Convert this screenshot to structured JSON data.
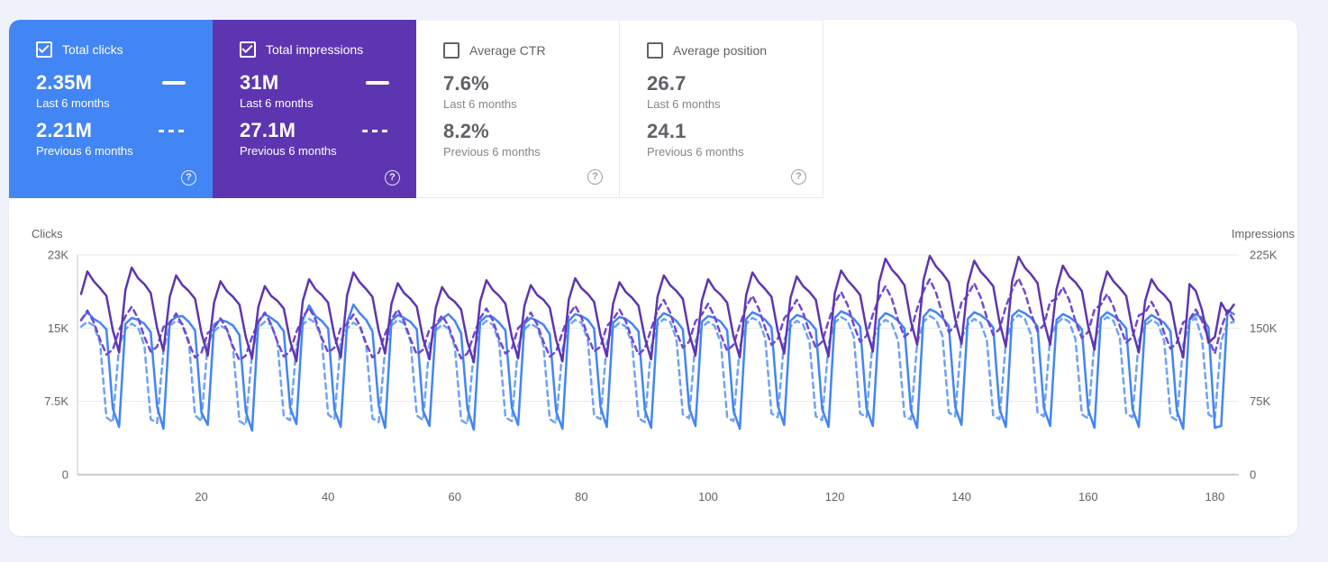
{
  "cards": [
    {
      "id": "total-clicks",
      "label": "Total clicks",
      "checked": true,
      "color": "#4285f4",
      "value_current": "2.35M",
      "caption_current": "Last 6 months",
      "value_previous": "2.21M",
      "caption_previous": "Previous 6 months",
      "help_glyph": "?"
    },
    {
      "id": "total-impressions",
      "label": "Total impressions",
      "checked": true,
      "color": "#5e35b1",
      "value_current": "31M",
      "caption_current": "Last 6 months",
      "value_previous": "27.1M",
      "caption_previous": "Previous 6 months",
      "help_glyph": "?"
    },
    {
      "id": "average-ctr",
      "label": "Average CTR",
      "checked": false,
      "color": "",
      "value_current": "7.6%",
      "caption_current": "Last 6 months",
      "value_previous": "8.2%",
      "caption_previous": "Previous 6 months",
      "help_glyph": "?"
    },
    {
      "id": "average-position",
      "label": "Average position",
      "checked": false,
      "color": "",
      "value_current": "26.7",
      "caption_current": "Last 6 months",
      "value_previous": "24.1",
      "caption_previous": "Previous 6 months",
      "help_glyph": "?"
    }
  ],
  "chart_data": {
    "type": "line",
    "x_range": [
      1,
      183
    ],
    "x_ticks": [
      20,
      40,
      60,
      80,
      100,
      120,
      140,
      160,
      180
    ],
    "grid": true,
    "values_unit": "thousands",
    "left_axis": {
      "title": "Clicks",
      "max": 23,
      "tick_labels": [
        "23K",
        "15K",
        "7.5K",
        "0"
      ],
      "tick_values": [
        225,
        150,
        75,
        0
      ]
    },
    "right_axis": {
      "title": "Impressions",
      "max": 225,
      "tick_labels": [
        "225K",
        "150K",
        "75K",
        "0"
      ],
      "tick_values": [
        225,
        150,
        75,
        0
      ]
    },
    "series": [
      {
        "name": "Clicks - Last 6 months",
        "axis": "left",
        "style": "solid",
        "color": "#4285f4",
        "values": [
          16.2,
          17.0,
          16.3,
          15.9,
          15.2,
          6.9,
          5.0,
          15.8,
          16.4,
          16.2,
          15.8,
          14.9,
          7.1,
          4.8,
          16.0,
          16.5,
          16.6,
          16.0,
          15.1,
          6.5,
          5.2,
          15.7,
          16.2,
          16.0,
          15.6,
          14.6,
          6.6,
          4.6,
          16.1,
          16.8,
          16.4,
          15.9,
          15.0,
          7.0,
          5.3,
          16.2,
          17.7,
          16.6,
          16.1,
          15.3,
          6.8,
          5.0,
          15.9,
          17.8,
          16.9,
          16.2,
          15.0,
          7.2,
          4.9,
          16.1,
          16.7,
          16.4,
          16.0,
          15.2,
          6.7,
          5.1,
          15.6,
          16.3,
          16.8,
          16.1,
          14.8,
          6.9,
          4.7,
          16.0,
          16.6,
          16.5,
          15.9,
          15.1,
          7.0,
          5.2,
          15.8,
          16.4,
          16.1,
          15.7,
          14.7,
          6.6,
          4.8,
          16.1,
          16.8,
          16.6,
          16.2,
          15.3,
          7.1,
          5.0,
          15.9,
          16.5,
          16.3,
          15.8,
          15.0,
          6.8,
          4.9,
          16.2,
          16.9,
          16.6,
          16.1,
          15.2,
          7.0,
          5.1,
          16.0,
          16.6,
          16.4,
          16.0,
          15.1,
          6.7,
          4.8,
          16.3,
          17.0,
          16.7,
          16.2,
          15.4,
          7.2,
          5.2,
          16.1,
          16.7,
          16.5,
          16.0,
          15.2,
          6.9,
          5.0,
          16.4,
          17.1,
          16.8,
          16.3,
          15.5,
          7.0,
          5.1,
          16.2,
          16.9,
          16.6,
          16.1,
          15.3,
          6.8,
          4.9,
          16.5,
          17.3,
          17.0,
          16.4,
          15.6,
          7.1,
          5.2,
          16.3,
          17.0,
          16.7,
          16.2,
          15.4,
          6.9,
          5.0,
          16.6,
          17.2,
          16.9,
          16.4,
          15.5,
          7.0,
          5.1,
          16.2,
          16.8,
          16.5,
          16.0,
          15.2,
          6.8,
          4.9,
          16.4,
          17.0,
          16.6,
          16.1,
          15.3,
          6.9,
          5.0,
          16.1,
          16.7,
          16.3,
          15.9,
          15.0,
          6.7,
          4.8,
          16.2,
          16.8,
          16.4,
          15.4,
          4.9,
          5.1,
          17.2,
          16.8
        ]
      },
      {
        "name": "Clicks - Previous 6 months",
        "axis": "left",
        "style": "dashed",
        "color": "#6da2f8",
        "values": [
          15.5,
          16.0,
          15.6,
          13.8,
          6.0,
          5.5,
          13.5,
          15.2,
          15.8,
          15.4,
          13.5,
          5.8,
          5.4,
          13.0,
          15.6,
          16.1,
          15.8,
          14.0,
          6.2,
          5.6,
          13.8,
          15.0,
          15.6,
          15.2,
          13.2,
          5.6,
          5.2,
          12.8,
          15.4,
          16.0,
          15.7,
          13.9,
          6.1,
          5.7,
          13.4,
          15.7,
          16.3,
          15.9,
          14.2,
          6.3,
          5.8,
          14.0,
          15.3,
          15.9,
          15.5,
          13.6,
          5.9,
          5.5,
          13.2,
          15.6,
          16.2,
          15.8,
          14.0,
          6.2,
          5.7,
          13.7,
          15.1,
          15.7,
          15.3,
          13.4,
          5.7,
          5.3,
          12.9,
          15.5,
          16.1,
          15.7,
          13.8,
          6.0,
          5.6,
          13.5,
          15.2,
          15.8,
          15.4,
          13.5,
          5.8,
          5.4,
          13.1,
          15.6,
          16.2,
          15.9,
          14.1,
          6.2,
          5.8,
          13.8,
          15.3,
          15.9,
          15.5,
          13.7,
          5.9,
          5.5,
          13.3,
          15.7,
          16.3,
          16.0,
          14.2,
          6.3,
          5.9,
          14.0,
          15.4,
          16.0,
          15.6,
          13.8,
          6.0,
          5.6,
          13.4,
          15.8,
          16.4,
          16.1,
          14.3,
          6.4,
          6.0,
          14.1,
          15.5,
          16.1,
          15.7,
          13.9,
          6.1,
          5.7,
          13.6,
          15.9,
          16.5,
          16.1,
          14.4,
          6.4,
          6.0,
          14.2,
          15.6,
          16.2,
          15.8,
          14.0,
          6.1,
          5.8,
          13.7,
          16.0,
          16.6,
          16.2,
          14.5,
          6.5,
          6.1,
          14.3,
          15.7,
          16.3,
          15.9,
          14.1,
          6.2,
          5.8,
          13.8,
          16.1,
          16.7,
          16.3,
          14.6,
          6.5,
          6.1,
          14.4,
          15.8,
          16.4,
          16.0,
          14.2,
          6.3,
          5.9,
          13.9,
          16.0,
          16.5,
          16.1,
          14.3,
          6.4,
          6.0,
          14.1,
          15.6,
          16.2,
          15.8,
          14.0,
          6.1,
          5.7,
          13.6,
          15.9,
          16.4,
          14.2,
          6.3,
          5.9,
          14.0,
          15.8,
          16.0
        ]
      },
      {
        "name": "Impressions - Last 6 months",
        "axis": "right",
        "style": "solid",
        "color": "#5e35b1",
        "values": [
          185,
          208,
          198,
          191,
          183,
          148,
          125,
          189,
          212,
          201,
          195,
          186,
          150,
          127,
          182,
          204,
          194,
          188,
          180,
          145,
          122,
          176,
          198,
          188,
          182,
          174,
          141,
          119,
          172,
          193,
          183,
          178,
          170,
          137,
          116,
          178,
          200,
          190,
          184,
          176,
          142,
          120,
          184,
          207,
          197,
          190,
          182,
          147,
          124,
          175,
          196,
          186,
          180,
          172,
          139,
          118,
          171,
          192,
          182,
          177,
          169,
          136,
          115,
          177,
          199,
          189,
          183,
          175,
          141,
          119,
          173,
          194,
          184,
          179,
          171,
          138,
          116,
          179,
          201,
          191,
          185,
          177,
          143,
          121,
          175,
          197,
          187,
          181,
          173,
          140,
          118,
          182,
          204,
          194,
          188,
          180,
          145,
          122,
          178,
          200,
          190,
          184,
          176,
          142,
          120,
          184,
          207,
          197,
          190,
          182,
          147,
          124,
          181,
          203,
          193,
          187,
          179,
          144,
          121,
          186,
          209,
          199,
          192,
          184,
          149,
          126,
          197,
          221,
          210,
          203,
          194,
          157,
          133,
          199,
          224,
          213,
          206,
          197,
          159,
          134,
          195,
          219,
          208,
          201,
          193,
          156,
          131,
          198,
          223,
          212,
          205,
          196,
          158,
          133,
          190,
          214,
          203,
          197,
          188,
          152,
          128,
          185,
          208,
          198,
          191,
          183,
          148,
          125,
          178,
          200,
          190,
          184,
          176,
          142,
          120,
          195,
          188,
          168,
          135,
          141,
          176,
          165,
          174
        ]
      },
      {
        "name": "Impressions - Previous 6 months",
        "axis": "right",
        "style": "dashed",
        "color": "#7248d0",
        "values": [
          158,
          168,
          156,
          138,
          123,
          128,
          148,
          162,
          172,
          160,
          141,
          126,
          131,
          151,
          155,
          165,
          153,
          135,
          120,
          125,
          145,
          150,
          160,
          149,
          131,
          117,
          122,
          141,
          156,
          166,
          154,
          136,
          121,
          126,
          146,
          161,
          171,
          159,
          140,
          125,
          130,
          150,
          154,
          164,
          153,
          134,
          120,
          125,
          144,
          159,
          169,
          157,
          139,
          123,
          128,
          149,
          153,
          163,
          152,
          134,
          119,
          124,
          143,
          160,
          170,
          158,
          139,
          124,
          129,
          150,
          156,
          166,
          154,
          136,
          121,
          126,
          146,
          163,
          173,
          161,
          142,
          126,
          131,
          152,
          159,
          169,
          157,
          139,
          123,
          129,
          149,
          168,
          179,
          166,
          146,
          130,
          136,
          157,
          164,
          175,
          162,
          143,
          127,
          133,
          153,
          172,
          183,
          170,
          150,
          133,
          139,
          160,
          168,
          179,
          166,
          146,
          130,
          136,
          157,
          176,
          187,
          174,
          153,
          136,
          142,
          164,
          181,
          193,
          180,
          158,
          141,
          147,
          170,
          188,
          200,
          186,
          164,
          146,
          152,
          176,
          184,
          196,
          182,
          161,
          143,
          149,
          172,
          189,
          201,
          187,
          165,
          147,
          153,
          177,
          180,
          192,
          179,
          157,
          140,
          146,
          169,
          174,
          185,
          172,
          152,
          135,
          141,
          163,
          166,
          177,
          165,
          145,
          129,
          135,
          156,
          159,
          169,
          157,
          139,
          124,
          150,
          168,
          158
        ]
      }
    ]
  }
}
